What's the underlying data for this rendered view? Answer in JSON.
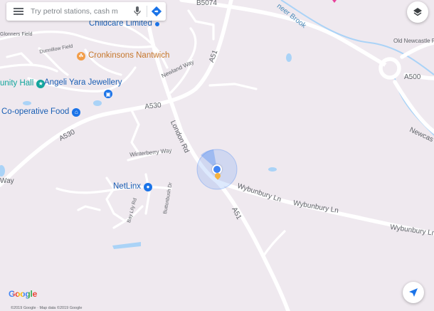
{
  "search": {
    "placeholder": "Try petrol stations, cash m"
  },
  "roads": {
    "b5074": "B5074",
    "a51_north": "A51",
    "a51_south": "A51",
    "a530_east": "A530",
    "a530_west": "A530",
    "a500": "A500",
    "london_rd": "London Rd",
    "newland_way": "Newland Way",
    "winterberry_way": "Winterberry Way",
    "wybunbury_ln_1": "Wybunbury Ln",
    "wybunbury_ln_2": "Wybunbury Ln",
    "wybunbury_ln_3": "Wybunbury Ln",
    "bay_lily_rd": "Bay Lily Rd",
    "butonbush_dr": "Buttonbush Dr",
    "old_newcastle_rd": "Old Newcastle R",
    "newcastle": "Newcas",
    "dunnillow_field": "Dunnillow Field",
    "glonners_field": "Glonners Field",
    "way_left": "Way",
    "brook": "neer Brook"
  },
  "pois": {
    "childcare": {
      "label": "Childcare Limited",
      "color": "#1a73e8"
    },
    "cronkinsons": {
      "label": "Cronkinsons Nantwich",
      "color": "#f29d48"
    },
    "angeli": {
      "label": "Angeli Yara Jewellery",
      "color": "#1a73e8"
    },
    "coop": {
      "label": "Co-operative Food",
      "color": "#1a73e8"
    },
    "netlinx": {
      "label": "NetLinx",
      "color": "#1a73e8"
    },
    "community_hall": {
      "label": "unity Hall",
      "color": "#12a59c"
    }
  },
  "footer": {
    "logo": "Google",
    "attribution": "©2019 Google · Map data ©2019 Google"
  },
  "icons": {
    "menu": "menu-icon",
    "mic": "microphone-icon",
    "directions": "directions-icon",
    "layers": "layers-icon",
    "locate": "navigation-arrow-icon",
    "location": "current-location-icon"
  }
}
